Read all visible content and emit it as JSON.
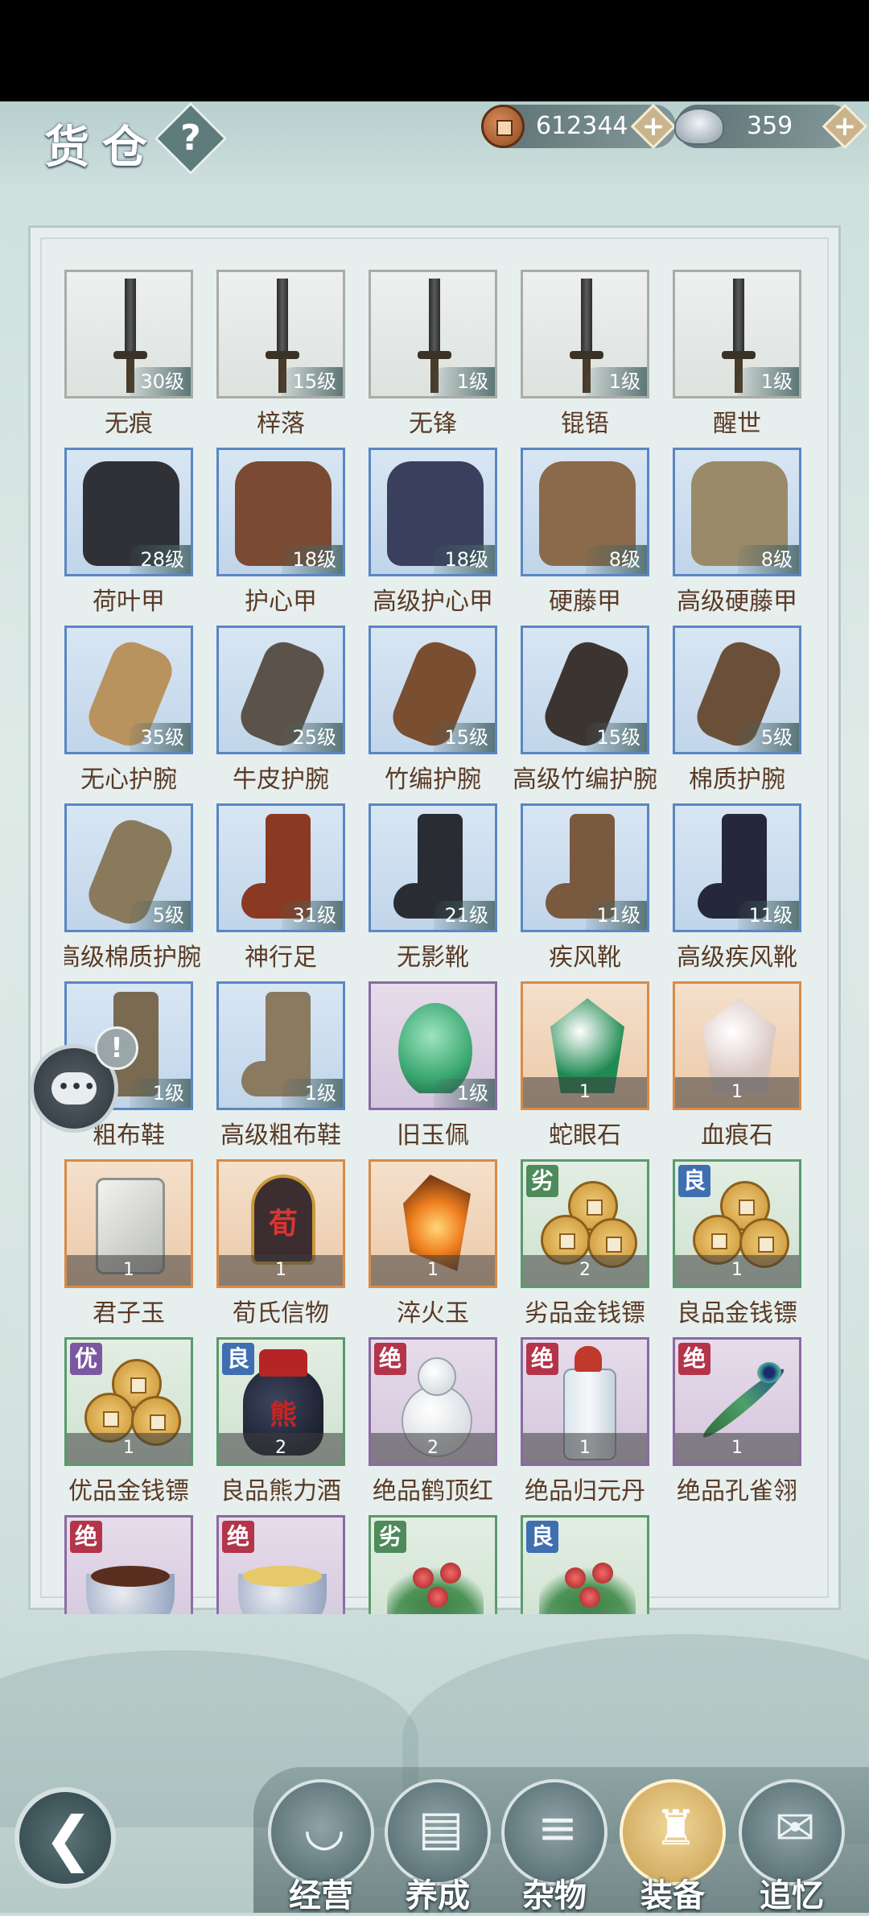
{
  "header": {
    "title": "货仓",
    "help_label": "?",
    "copper": {
      "icon": "copper-coin-icon",
      "value": "612344"
    },
    "silver": {
      "icon": "silver-ingot-icon",
      "value": "359"
    },
    "plus_label": "+"
  },
  "items": [
    {
      "name": "无痕",
      "level": "30级",
      "kind": "sword",
      "quality": "gray"
    },
    {
      "name": "梓落",
      "level": "15级",
      "kind": "sword",
      "quality": "gray"
    },
    {
      "name": "无锋",
      "level": "1级",
      "kind": "sword",
      "quality": "gray"
    },
    {
      "name": "锟铻",
      "level": "1级",
      "kind": "sword",
      "quality": "gray"
    },
    {
      "name": "醒世",
      "level": "1级",
      "kind": "sword",
      "quality": "gray"
    },
    {
      "name": "荷叶甲",
      "level": "28级",
      "kind": "armor",
      "color": "#2f3136",
      "quality": "blue"
    },
    {
      "name": "护心甲",
      "level": "18级",
      "kind": "armor",
      "color": "#7a4a32",
      "quality": "blue"
    },
    {
      "name": "高级护心甲",
      "level": "18级",
      "kind": "armor",
      "color": "#3a3f5e",
      "quality": "blue"
    },
    {
      "name": "硬藤甲",
      "level": "8级",
      "kind": "armor",
      "color": "#8a6a4a",
      "quality": "blue"
    },
    {
      "name": "高级硬藤甲",
      "level": "8级",
      "kind": "armor",
      "color": "#9a8a6a",
      "quality": "blue"
    },
    {
      "name": "无心护腕",
      "level": "35级",
      "kind": "bracer",
      "color": "#b8935e",
      "quality": "blue"
    },
    {
      "name": "牛皮护腕",
      "level": "25级",
      "kind": "bracer",
      "color": "#5b534a",
      "quality": "blue"
    },
    {
      "name": "竹编护腕",
      "level": "15级",
      "kind": "bracer",
      "color": "#7a4e30",
      "quality": "blue"
    },
    {
      "name": "高级竹编护腕",
      "level": "15级",
      "kind": "bracer",
      "color": "#3c3430",
      "quality": "blue"
    },
    {
      "name": "棉质护腕",
      "level": "5级",
      "kind": "bracer",
      "color": "#6a5038",
      "quality": "blue"
    },
    {
      "name": "高级棉质护腕",
      "level": "5级",
      "kind": "bracer",
      "color": "#8a7a5c",
      "quality": "blue"
    },
    {
      "name": "神行足",
      "level": "31级",
      "kind": "boot",
      "color": "#8a3a22",
      "quality": "blue"
    },
    {
      "name": "无影靴",
      "level": "21级",
      "kind": "boot",
      "color": "#2a2c34",
      "quality": "blue"
    },
    {
      "name": "疾风靴",
      "level": "11级",
      "kind": "boot",
      "color": "#7a5a3e",
      "quality": "blue"
    },
    {
      "name": "高级疾风靴",
      "level": "11级",
      "kind": "boot",
      "color": "#24283a",
      "quality": "blue"
    },
    {
      "name": "粗布鞋",
      "level": "1级",
      "kind": "boot",
      "color": "#7a6a52",
      "quality": "blue"
    },
    {
      "name": "高级粗布鞋",
      "level": "1级",
      "kind": "boot",
      "color": "#8a7a60",
      "quality": "blue"
    },
    {
      "name": "旧玉佩",
      "level": "1级",
      "kind": "jade",
      "color": "#3aa872",
      "quality": "purple"
    },
    {
      "name": "蛇眼石",
      "count": "1",
      "kind": "gem",
      "color": "#1f8a52",
      "quality": "orange"
    },
    {
      "name": "血痕石",
      "count": "1",
      "kind": "gem",
      "color": "#d9c7c2",
      "quality": "orange"
    },
    {
      "name": "君子玉",
      "count": "1",
      "kind": "plate",
      "quality": "orange"
    },
    {
      "name": "荀氏信物",
      "count": "1",
      "kind": "tag",
      "tag_text": "荀",
      "quality": "orange"
    },
    {
      "name": "淬火玉",
      "count": "1",
      "kind": "fire",
      "quality": "orange"
    },
    {
      "name": "劣品金钱镖",
      "count": "2",
      "kind": "coins",
      "badge": "劣",
      "badge_class": "b-bad",
      "quality": "green"
    },
    {
      "name": "良品金钱镖",
      "count": "1",
      "kind": "coins",
      "badge": "良",
      "badge_class": "b-good",
      "quality": "green"
    },
    {
      "name": "优品金钱镖",
      "count": "1",
      "kind": "coins",
      "badge": "优",
      "badge_class": "b-fine",
      "quality": "green"
    },
    {
      "name": "良品熊力酒",
      "count": "2",
      "kind": "jar",
      "jar_text": "熊",
      "badge": "良",
      "badge_class": "b-good",
      "quality": "green"
    },
    {
      "name": "绝品鹤顶红",
      "count": "2",
      "kind": "gourd",
      "badge": "绝",
      "badge_class": "b-top",
      "quality": "purple"
    },
    {
      "name": "绝品归元丹",
      "count": "1",
      "kind": "bottle",
      "badge": "绝",
      "badge_class": "b-top",
      "quality": "purple"
    },
    {
      "name": "绝品孔雀翎",
      "count": "1",
      "kind": "feather",
      "badge": "绝",
      "badge_class": "b-top",
      "quality": "purple"
    },
    {
      "name": "",
      "kind": "bowl",
      "badge": "绝",
      "badge_class": "b-top",
      "quality": "purple"
    },
    {
      "name": "",
      "kind": "bowl2",
      "badge": "绝",
      "badge_class": "b-top",
      "quality": "purple"
    },
    {
      "name": "",
      "kind": "plant",
      "badge": "劣",
      "badge_class": "b-bad",
      "quality": "green"
    },
    {
      "name": "",
      "kind": "plant",
      "badge": "良",
      "badge_class": "b-good",
      "quality": "green"
    }
  ],
  "chat": {
    "icon": "chat-bubble-icon",
    "dots": "•••",
    "alert": "!"
  },
  "nav": {
    "back_icon": "back-arrow-icon",
    "tabs": [
      {
        "label": "经营",
        "icon": "bowl-icon",
        "glyph": "◡"
      },
      {
        "label": "养成",
        "icon": "book-icon",
        "glyph": "▤"
      },
      {
        "label": "杂物",
        "icon": "bundle-icon",
        "glyph": "≡"
      },
      {
        "label": "装备",
        "icon": "robe-icon",
        "glyph": "♜",
        "active": true
      },
      {
        "label": "追忆",
        "icon": "letter-icon",
        "glyph": "✉"
      }
    ]
  }
}
